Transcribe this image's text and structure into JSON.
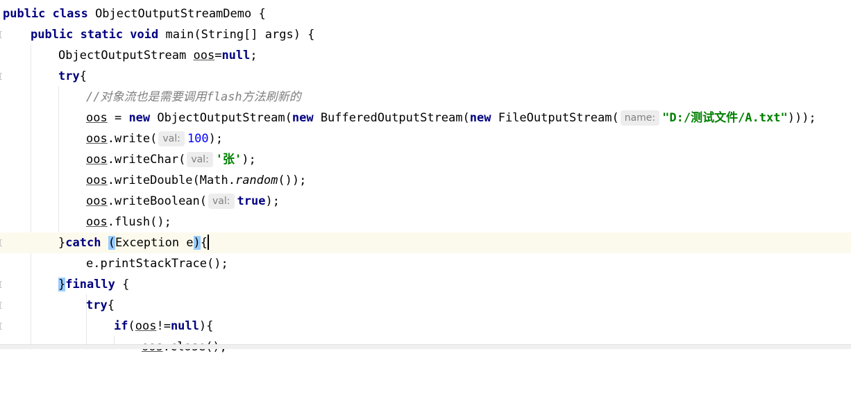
{
  "code": {
    "l1": {
      "kw": "public class",
      "name": " ObjectOutputStreamDemo {"
    },
    "l2": {
      "kw": "public static void",
      "rest": " main(String[] args) {"
    },
    "l3": {
      "type": "ObjectOutputStream ",
      "var": "oos",
      "eq": "=",
      "kw": "null",
      "end": ";"
    },
    "l4": {
      "kw": "try",
      "end": "{"
    },
    "l5": {
      "comment": "//对象流也是需要调用flash方法刷新的"
    },
    "l6": {
      "var": "oos",
      "a": " = ",
      "kw1": "new",
      "b": " ObjectOutputStream(",
      "kw2": "new",
      "c": " BufferedOutputStream(",
      "kw3": "new",
      "d": " FileOutputStream(",
      "hint": "name:",
      "str": "\"D:/测试文件/A.txt\"",
      "end": ")));"
    },
    "l7": {
      "var": "oos",
      "call": ".write(",
      "hint": "val:",
      "num": "100",
      "end": ");"
    },
    "l8": {
      "var": "oos",
      "call": ".writeChar(",
      "hint": "val:",
      "str": "'张'",
      "end": ");"
    },
    "l9": {
      "var": "oos",
      "call": ".writeDouble(Math.",
      "method": "random",
      "end": "());"
    },
    "l10": {
      "var": "oos",
      "call": ".writeBoolean(",
      "hint": "val:",
      "kw": "true",
      "end": ");"
    },
    "l11": {
      "var": "oos",
      "call": ".flush();"
    },
    "l12": {
      "brace": "}",
      "kw": "catch",
      "sp": " ",
      "paren": "(",
      "text": "Exception e",
      "paren2": ")",
      "brace2": "{"
    },
    "l13": {
      "text": "e.printStackTrace();"
    },
    "l14": {
      "brace": "}",
      "kw": "finally",
      "end": " {"
    },
    "l15": {
      "kw": "try",
      "end": "{"
    },
    "l16": {
      "kw": "if",
      "a": "(",
      "var": "oos",
      "b": "!=",
      "kw2": "null",
      "end": "){"
    },
    "l17": {
      "var": "oos",
      "call": ".close();"
    }
  }
}
